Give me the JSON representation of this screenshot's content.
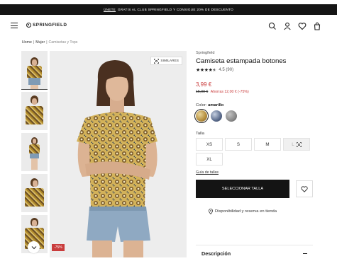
{
  "promo": {
    "link": "ÚNETE",
    "text": "GRATIS AL CLUB SPRINGFIELD Y CONSIGUE 20% DE DESCUENTO"
  },
  "header": {
    "logo": "SPRINGFIELD",
    "icons": [
      "search-icon",
      "user-icon",
      "heart-icon",
      "bag-icon"
    ]
  },
  "breadcrumb": [
    "Home",
    "Mujer",
    "Camisetas y Tops"
  ],
  "gallery": {
    "similares_label": "SIMILARES",
    "discount_badge": "-75%",
    "thumbnail_count": 5
  },
  "product": {
    "brand": "Springfield",
    "title": "Camiseta estampada botones",
    "rating": 4.5,
    "rating_text": "4.5 (90)",
    "price": "3,99 €",
    "old_price": "15,99 €",
    "savings": "Ahorras 12,00 € (-75%)",
    "color_label": "Color:",
    "color_value": "amarillo",
    "swatches": [
      {
        "name": "amarillo",
        "color": "#c9a55a",
        "selected": true
      },
      {
        "name": "azul",
        "color": "#5a6b8c",
        "selected": false
      },
      {
        "name": "gris",
        "color": "#8a8a8a",
        "selected": false
      }
    ],
    "size_label": "Talla",
    "sizes": [
      {
        "label": "XS",
        "available": true
      },
      {
        "label": "S",
        "available": true
      },
      {
        "label": "M",
        "available": true
      },
      {
        "label": "L",
        "available": false
      },
      {
        "label": "XL",
        "available": true
      }
    ],
    "size_guide": "Guía de tallas",
    "select_button": "SELECCIONAR TALLA",
    "availability": "Disponibilidad y reserva en tienda",
    "description_label": "Descripción"
  },
  "colors": {
    "accent": "#c93c3c",
    "dark": "#141414"
  }
}
